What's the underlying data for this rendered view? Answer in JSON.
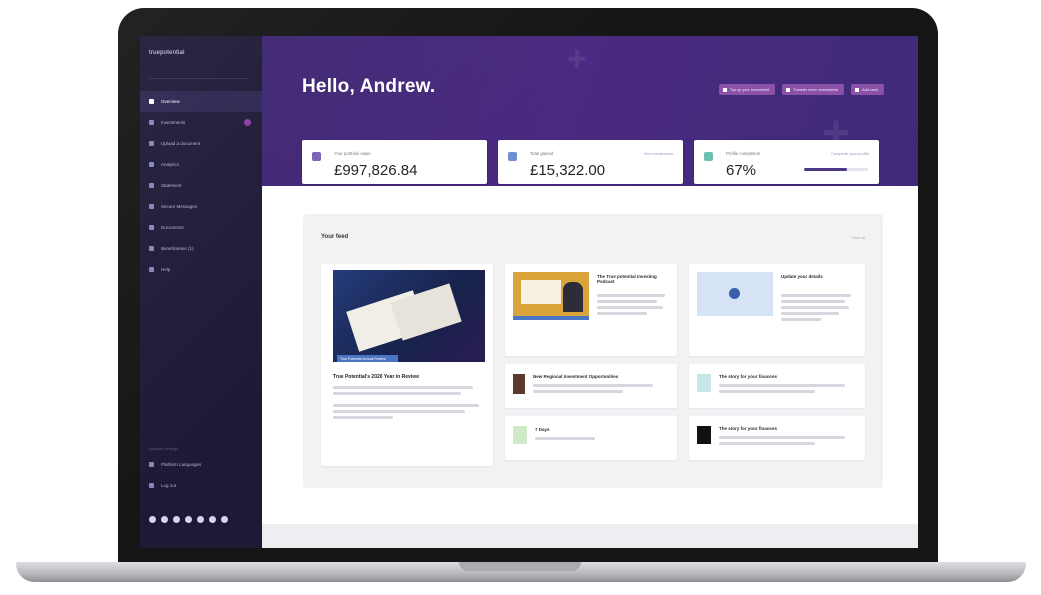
{
  "sidebar": {
    "logo": "truepotential",
    "items": [
      {
        "label": "Overview",
        "icon": "home-icon",
        "active": true
      },
      {
        "label": "Investments",
        "icon": "chart-icon",
        "badge": true
      },
      {
        "label": "Upload a document",
        "icon": "upload-icon"
      },
      {
        "label": "Analytics",
        "icon": "analytics-icon"
      },
      {
        "label": "Statement",
        "icon": "statement-icon"
      },
      {
        "label": "Secure Messages",
        "icon": "message-icon"
      },
      {
        "label": "Documents",
        "icon": "document-icon"
      },
      {
        "label": "Beneficiaries (1)",
        "icon": "people-icon"
      },
      {
        "label": "Help",
        "icon": "help-icon"
      }
    ],
    "footer_label": "Account settings",
    "footer_links": [
      {
        "label": "Platform Languages",
        "icon": "globe-icon"
      },
      {
        "label": "Log out",
        "icon": "logout-icon"
      }
    ],
    "social": [
      "facebook-icon",
      "twitter-icon",
      "youtube-icon",
      "linkedin-icon",
      "instagram-icon",
      "email-icon",
      "share-icon"
    ]
  },
  "header": {
    "greeting": "Hello, Andrew.",
    "actions": [
      "Top up your investment",
      "Transfer more investments",
      "Add cash"
    ]
  },
  "stats": [
    {
      "label": "Your portfolio value",
      "value": "£997,826.84",
      "link": "",
      "icon_color": "#7a63b8"
    },
    {
      "label": "Total gained",
      "value": "£15,322.00",
      "link": "View breakdown",
      "icon_color": "#6e8fd0"
    },
    {
      "label": "Profile completion",
      "value": "67%",
      "link": "Complete your profile",
      "progress": 0.67,
      "icon_color": "#6ec0b4"
    }
  ],
  "feed": {
    "title": "Your feed",
    "view_all": "View all",
    "featured": {
      "tag": "True Potential Annual Review",
      "title": "True Potential's 2020 Year in Review"
    },
    "cards": [
      {
        "title": "The True potential Investing Podcast",
        "kind": "video"
      },
      {
        "title": "Update your details",
        "kind": "info"
      },
      {
        "title": "New Regional Investment Opportunities",
        "kind": "article"
      },
      {
        "title": "The story for your finances",
        "kind": "article"
      },
      {
        "title": "7 Days",
        "kind": "article"
      },
      {
        "title": "The story for your finances",
        "kind": "article"
      }
    ]
  }
}
